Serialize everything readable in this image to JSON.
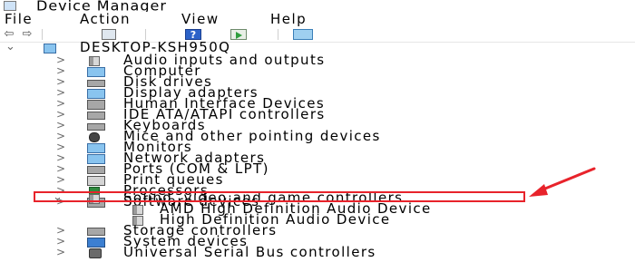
{
  "window": {
    "title": "Device Manager"
  },
  "menu": {
    "items": [
      "File",
      "Action",
      "View",
      "Help"
    ]
  },
  "toolbar": {
    "icons": [
      "back-arrow-icon",
      "forward-arrow-icon",
      "properties-grid-icon",
      "help-icon",
      "play-icon",
      "monitor-icon"
    ],
    "help_label": "?"
  },
  "tree": {
    "root": "DESKTOP-KSH950Q",
    "categories": [
      "Audio inputs and outputs",
      "Computer",
      "Disk drives",
      "Display adapters",
      "Human Interface Devices",
      "IDE ATA/ATAPI controllers",
      "Keyboards",
      "Mice and other pointing devices",
      "Monitors",
      "Network adapters",
      "Ports (COM & LPT)",
      "Print queues",
      "Processors",
      "Software devices",
      "Sound, video and game controllers",
      "Storage controllers",
      "System devices",
      "Universal Serial Bus controllers"
    ],
    "sound_children": [
      "AMD High Definition Audio Device",
      "High Definition Audio Device"
    ]
  },
  "annotation": {
    "color": "#e8232b"
  },
  "colors": {
    "text": "#000000",
    "background": "#ffffff",
    "expander": "#6a6a6a"
  }
}
